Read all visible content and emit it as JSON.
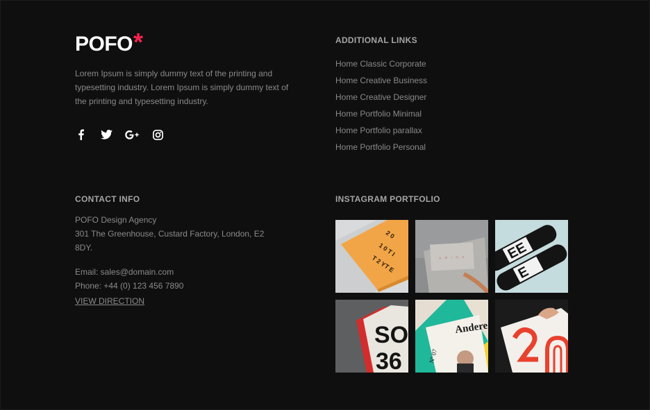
{
  "brand": {
    "name": "POFO",
    "mark": "*",
    "accent": "#ff214f"
  },
  "about": {
    "text": "Lorem Ipsum is simply dummy text of the printing and typesetting industry. Lorem Ipsum is simply dummy text of the printing and typesetting industry."
  },
  "social": [
    "facebook-icon",
    "twitter-icon",
    "google-plus-icon",
    "instagram-icon"
  ],
  "additional_links": {
    "heading": "ADDITIONAL LINKS",
    "items": [
      "Home Classic Corporate",
      "Home Creative Business",
      "Home Creative Designer",
      "Home Portfolio Minimal",
      "Home Portfolio parallax",
      "Home Portfolio Personal"
    ]
  },
  "contact": {
    "heading": "CONTACT INFO",
    "agency": "POFO Design Agency",
    "address": "301 The Greenhouse, Custard Factory, London, E2 8DY.",
    "email": "Email: sales@domain.com",
    "phone": "Phone: +44 (0) 123 456 7890",
    "direction": "VIEW DIRECTION"
  },
  "instagram": {
    "heading": "INSTAGRAM PORTFOLIO"
  },
  "colors": {
    "background": "#0f0f0f",
    "text": "#8a8a8a",
    "heading": "#a5a5a5"
  }
}
